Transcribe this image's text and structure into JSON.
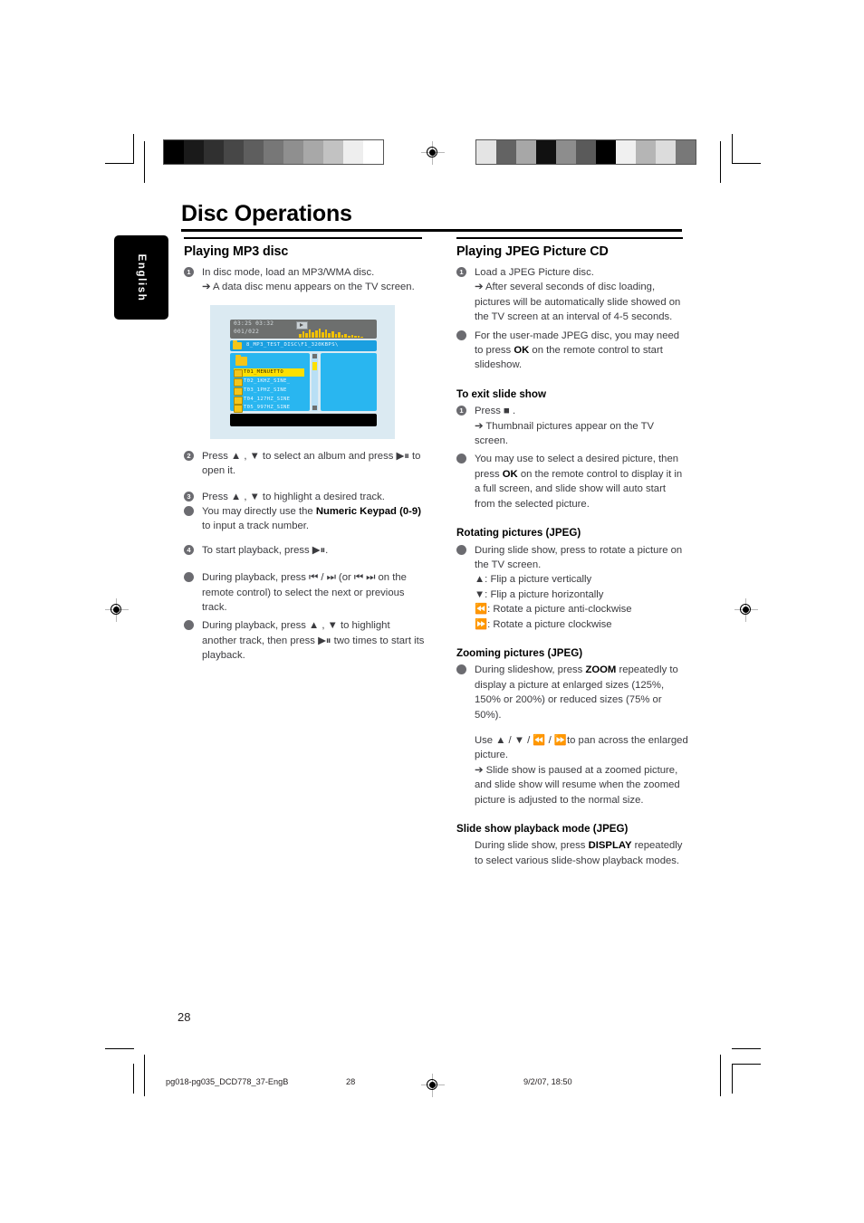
{
  "document": {
    "title": "Disc Operations",
    "language_tab": "English",
    "page_number": "28"
  },
  "left_column": {
    "heading": "Playing MP3 disc",
    "steps": [
      {
        "marker": "1",
        "text": "In disc mode, load an MP3/WMA disc.",
        "sub": "➔ A data disc menu appears on the TV screen."
      },
      {
        "marker": "2",
        "text": "Press ▲ , ▼ to select an album and press ▶⏸ to open it."
      },
      {
        "marker": "3",
        "text": "Press ▲ , ▼ to highlight a desired track."
      },
      {
        "marker": "●",
        "text_pre": " You may directly use the ",
        "bold": "Numeric Keypad (0-9)",
        "text_post": " to input a track number."
      },
      {
        "marker": "4",
        "text": "To start playback, press ▶⏸."
      },
      {
        "marker": "●",
        "text": "During playback, press ⏮ / ⏭ (or ⏮ ⏭ on the remote control) to select the next or previous track."
      },
      {
        "marker": "●",
        "text": "During playback, press ▲ , ▼ to highlight another track, then press ▶⏸ two times to start its playback."
      }
    ]
  },
  "right_column": {
    "heading": "Playing JPEG Picture CD",
    "steps": [
      {
        "marker": "1",
        "text": "Load a JPEG Picture disc.",
        "sub": "➔ After several seconds of disc loading, pictures will be automatically slide showed on the TV screen at an interval of 4-5 seconds."
      },
      {
        "marker": "●",
        "text_pre": " For the user-made JPEG disc, you may need to press ",
        "bold": "OK",
        "text_post": " on the remote control to start slideshow."
      }
    ],
    "exit_section": {
      "heading": "To exit slide show",
      "step_marker": "1",
      "step_text": "Press ■ .",
      "step_sub": "➔ Thumbnail pictures appear on the TV screen.",
      "bullet_marker": "●",
      "bullet_pre": "You may use  to select a desired picture, then press ",
      "bullet_bold": "OK",
      "bullet_post": " on the remote control to display it in a full screen, and slide show will auto start from the selected picture."
    },
    "rotating_section": {
      "heading": "Rotating pictures (JPEG)",
      "marker": "●",
      "intro": "During slide show, press  to rotate a picture on the TV screen.",
      "items": [
        "▲: Flip a picture vertically",
        "▼: Flip a picture horizontally",
        "⏪: Rotate a picture anti-clockwise",
        "⏩: Rotate a picture clockwise"
      ]
    },
    "zooming_section": {
      "heading": "Zooming pictures (JPEG)",
      "marker": "●",
      "text_pre": "During slideshow, press ",
      "bold": "ZOOM",
      "text_post": " repeatedly to display a picture at enlarged sizes (125%, 150% or 200%) or reduced sizes (75% or 50%).",
      "pan_text": "Use ▲ / ▼ / ⏪ /  ⏩to pan across the enlarged picture.",
      "pan_sub": "➔ Slide show is paused at a zoomed picture, and slide show will resume when the zoomed picture is adjusted to the normal size."
    },
    "slideshow_section": {
      "heading": "Slide show playback mode (JPEG)",
      "text_pre": "During slide show, press ",
      "bold": "DISPLAY",
      "text_post": " repeatedly to select various slide-show playback modes."
    }
  },
  "figure": {
    "caption": "data-disc-menu-screenshot",
    "status_bar": {
      "elapsed": "03:25 03:32",
      "track_count": "001/022",
      "play_icon": "play-icon"
    },
    "path_bar": {
      "icon": "folder-icon",
      "path": "8_MP3_TEST_DISC\\F1_320KBPS\\"
    },
    "tracks": [
      {
        "label": "T01_MENUETTO",
        "selected": true
      },
      {
        "label": "T02_1KHZ_SINE_",
        "selected": false
      },
      {
        "label": "T03_1PHZ_SINE",
        "selected": false
      },
      {
        "label": "T04_127HZ_SINE",
        "selected": false
      },
      {
        "label": "T05_997HZ_SINE",
        "selected": false
      }
    ],
    "colors": {
      "screen_bg": "#dbeaf2",
      "list_bg": "#29b6f0",
      "highlight": "#ffe000",
      "status_bg": "#6d6f6e",
      "path_bg": "#1a9fe0"
    }
  },
  "footer": {
    "file_name": "pg018-pg035_DCD778_37-EngB",
    "page": "28",
    "timestamp": "9/2/07, 18:50"
  }
}
